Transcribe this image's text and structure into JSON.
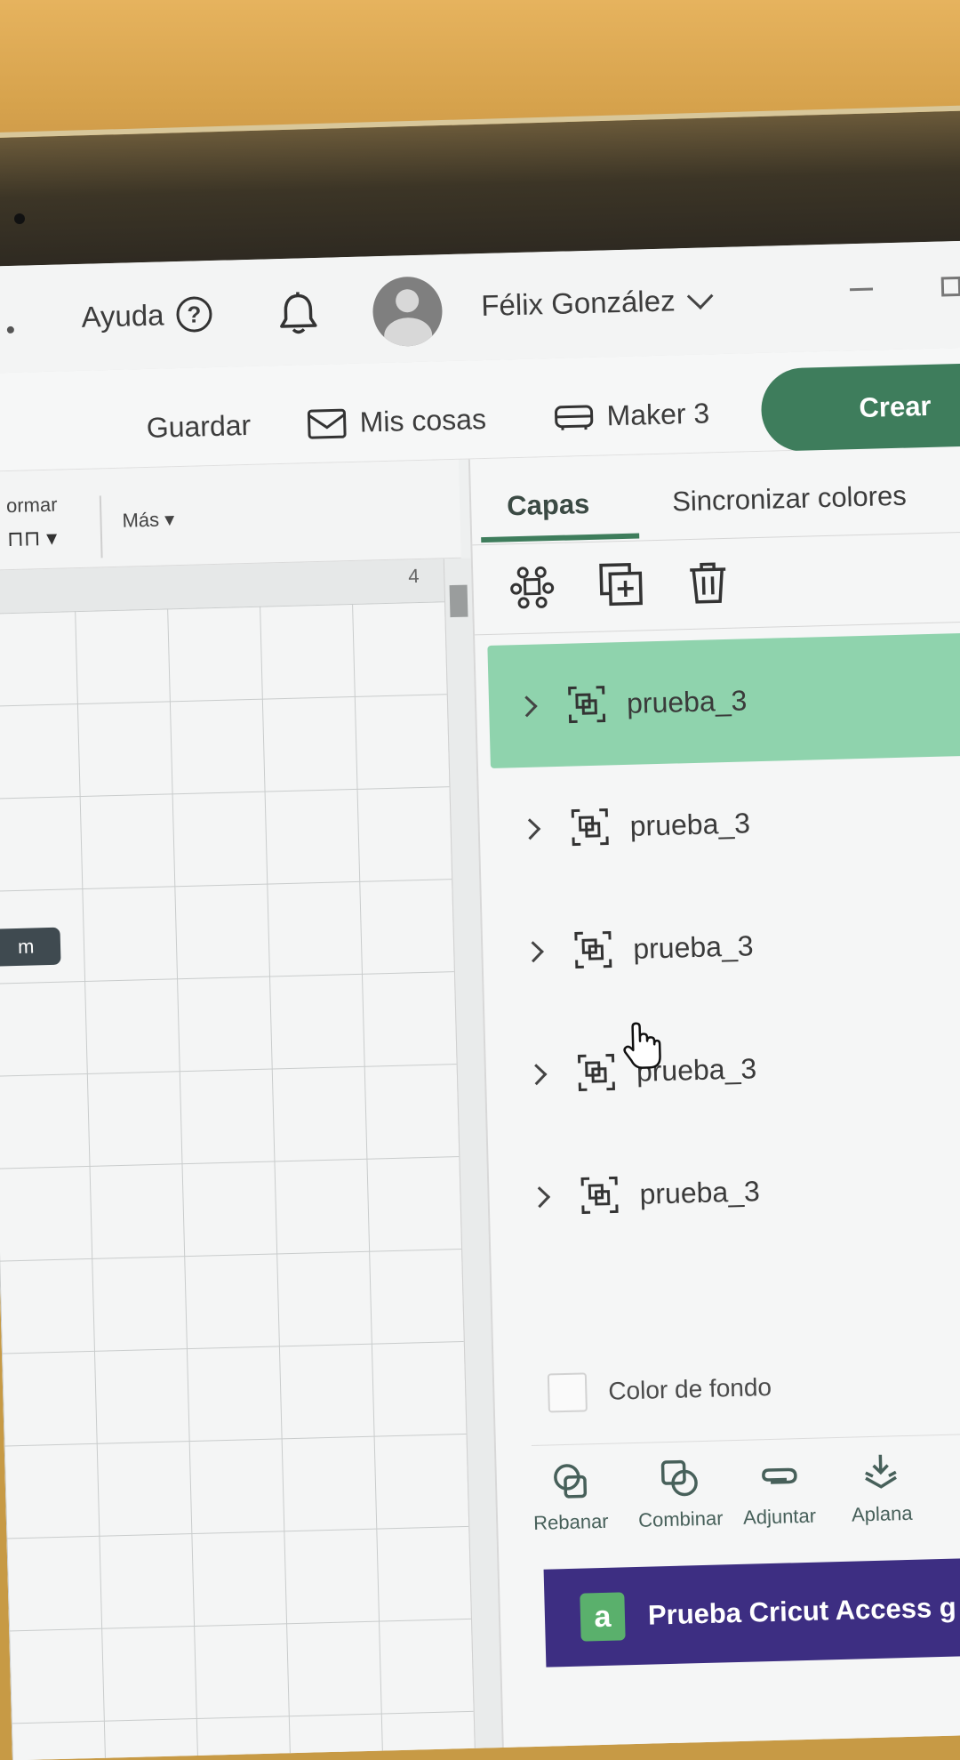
{
  "header": {
    "help_label": "Ayuda",
    "help_glyph": "?",
    "user_name": "Félix González"
  },
  "actions": {
    "save_label": "Guardar",
    "my_stuff_label": "Mis cosas",
    "machine_label": "Maker 3",
    "create_label": "Crear"
  },
  "toolbar": {
    "arrange_label": "ormar",
    "more_label": "Más ▾",
    "ruler_mark": "4",
    "dimension_badge": "m"
  },
  "panel": {
    "tabs": [
      {
        "label": "Capas",
        "active": true
      },
      {
        "label": "Sincronizar colores",
        "active": false
      }
    ],
    "layers": [
      {
        "name": "prueba_3",
        "selected": true
      },
      {
        "name": "prueba_3",
        "selected": false
      },
      {
        "name": "prueba_3",
        "selected": false
      },
      {
        "name": "prueba_3",
        "selected": false
      },
      {
        "name": "prueba_3",
        "selected": false
      }
    ],
    "background_color_label": "Color de fondo",
    "bottom_tools": [
      {
        "label": "Rebanar",
        "icon": "slice-icon"
      },
      {
        "label": "Combinar",
        "icon": "combine-icon"
      },
      {
        "label": "Adjuntar",
        "icon": "attach-icon"
      },
      {
        "label": "Aplana",
        "icon": "flatten-icon"
      }
    ],
    "access_banner": "Prueba Cricut Access g",
    "access_logo_glyph": "a"
  },
  "colors": {
    "accent_green": "#3e7d5c",
    "selected_layer": "#8fd3ad",
    "access_banner": "#3d2e82"
  }
}
